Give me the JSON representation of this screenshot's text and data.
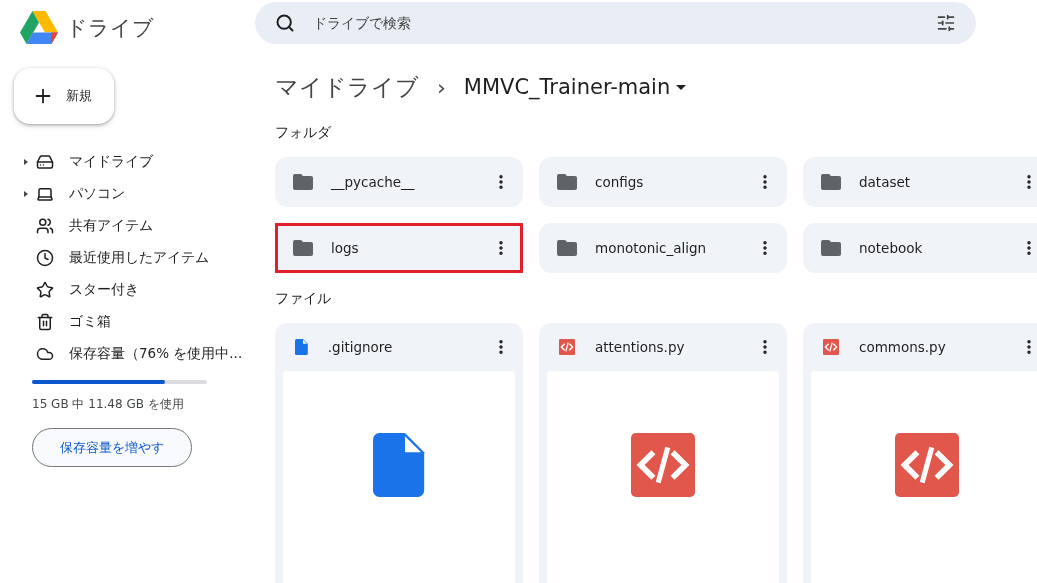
{
  "app": {
    "title": "ドライブ"
  },
  "search": {
    "placeholder": "ドライブで検索"
  },
  "new_button": {
    "label": "新規"
  },
  "sidebar": {
    "items": [
      {
        "label": "マイドライブ",
        "expandable": true
      },
      {
        "label": "パソコン",
        "expandable": true
      },
      {
        "label": "共有アイテム",
        "expandable": false
      },
      {
        "label": "最近使用したアイテム",
        "expandable": false
      },
      {
        "label": "スター付き",
        "expandable": false
      },
      {
        "label": "ゴミ箱",
        "expandable": false
      },
      {
        "label": "保存容量（76% を使用中...",
        "expandable": false
      }
    ]
  },
  "storage": {
    "level": 0.76,
    "usage": "15 GB 中 11.48 GB を使用",
    "button": "保存容量を増やす"
  },
  "breadcrumb": {
    "root": "マイドライブ",
    "separator": "›",
    "current": "MMVC_Trainer-main"
  },
  "folders": {
    "heading": "フォルダ",
    "items": [
      {
        "name": "__pycache__",
        "highlighted": false
      },
      {
        "name": "configs",
        "highlighted": false
      },
      {
        "name": "dataset",
        "highlighted": false
      },
      {
        "name": "logs",
        "highlighted": true
      },
      {
        "name": "monotonic_align",
        "highlighted": false
      },
      {
        "name": "notebook",
        "highlighted": false
      }
    ]
  },
  "files": {
    "heading": "ファイル",
    "items": [
      {
        "name": ".gitignore",
        "kind": "document"
      },
      {
        "name": "attentions.py",
        "kind": "code"
      },
      {
        "name": "commons.py",
        "kind": "code"
      }
    ]
  }
}
